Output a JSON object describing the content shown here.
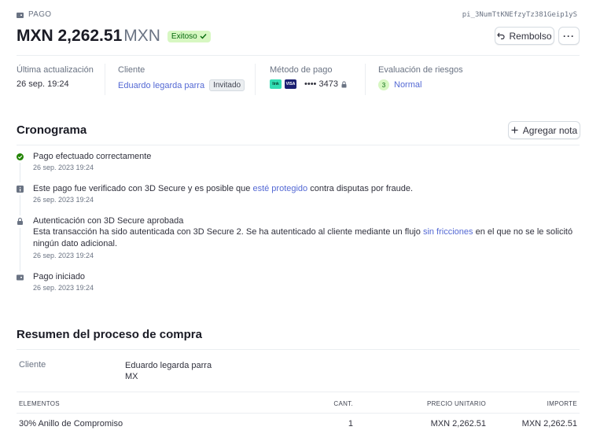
{
  "header": {
    "section_label": "PAGO",
    "payment_id": "pi_3NumTtKNEfzyTz381Geip1yS",
    "amount": "MXN 2,262.51",
    "currency": "MXN",
    "status": "Exitoso",
    "refund_label": "Rembolso",
    "more_label": "···"
  },
  "meta": {
    "updated_label": "Última actualización",
    "updated_value": "26 sep. 19:24",
    "customer_label": "Cliente",
    "customer_name": "Eduardo legarda parra",
    "customer_badge": "Invitado",
    "method_label": "Método de pago",
    "card_brand_1": "link",
    "card_brand_2": "VISA",
    "card_last4": "•••• 3473",
    "risk_label": "Evaluación de riesgos",
    "risk_score": "3",
    "risk_value": "Normal"
  },
  "timeline": {
    "title": "Cronograma",
    "add_note_label": "Agregar nota",
    "events": [
      {
        "title": "Pago efectuado correctamente",
        "date": "26 sep. 2023 19:24",
        "icon": "check-circle-icon"
      },
      {
        "title_pre": "Este pago fue verificado con 3D Secure y es posible que ",
        "title_link": "esté protegido",
        "title_post": " contra disputas por fraude.",
        "date": "26 sep. 2023 19:24",
        "icon": "info-icon"
      },
      {
        "title": "Autenticación con 3D Secure aprobada",
        "desc_pre": "Esta transacción ha sido autenticada con 3D Secure 2. Se ha autenticado al cliente mediante un flujo ",
        "desc_link": "sin fricciones",
        "desc_post": " en el que no se le solicitó ningún dato adicional.",
        "date": "26 sep. 2023 19:24",
        "icon": "lock-icon"
      },
      {
        "title": "Pago iniciado",
        "date": "26 sep. 2023 19:24",
        "icon": "wallet-icon"
      }
    ]
  },
  "summary": {
    "title": "Resumen del proceso de compra",
    "customer_label": "Cliente",
    "customer_name": "Eduardo legarda parra",
    "customer_country": "MX",
    "columns": [
      "ELEMENTOS",
      "CANT.",
      "PRECIO UNITARIO",
      "IMPORTE"
    ],
    "rows": [
      {
        "item": "30% Anillo de Compromiso",
        "qty": "1",
        "unit_price": "MXN 2,262.51",
        "amount": "MXN 2,262.51"
      }
    ]
  },
  "colors": {
    "accent": "#5469d4",
    "success": "#05690d",
    "success_bg": "#d7f7c2"
  }
}
